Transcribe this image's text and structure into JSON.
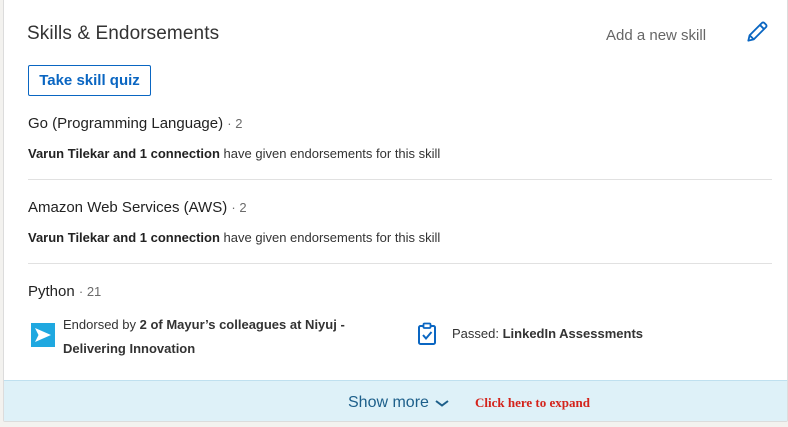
{
  "header": {
    "title": "Skills & Endorsements",
    "add_skill": "Add a new skill",
    "edit_icon": "pencil-icon"
  },
  "quiz_button": "Take skill quiz",
  "skills": [
    {
      "name": "Go (Programming Language)",
      "count": "· 2",
      "endorsers": "Varun Tilekar and 1 connection",
      "endorse_suffix": " have given endorsements for this skill"
    },
    {
      "name": "Amazon Web Services (AWS)",
      "count": "· 2",
      "endorsers": "Varun Tilekar and 1 connection",
      "endorse_suffix": " have given endorsements for this skill"
    },
    {
      "name": "Python",
      "count": "· 21",
      "colleagues": {
        "prefix": "Endorsed by ",
        "bold": "2 of Mayur’s colleagues at Niyuj - Delivering Innovation",
        "icon": "company-logo-icon"
      },
      "assessment": {
        "prefix": "Passed: ",
        "bold": "LinkedIn Assessments",
        "icon": "clipboard-check-icon"
      }
    }
  ],
  "footer": {
    "show_more": "Show more",
    "hint": "Click here to expand"
  },
  "colors": {
    "accent": "#0a66c2",
    "footer_bg": "#def1f8",
    "hint": "#d4231b",
    "logo": "#1fa8e0"
  }
}
